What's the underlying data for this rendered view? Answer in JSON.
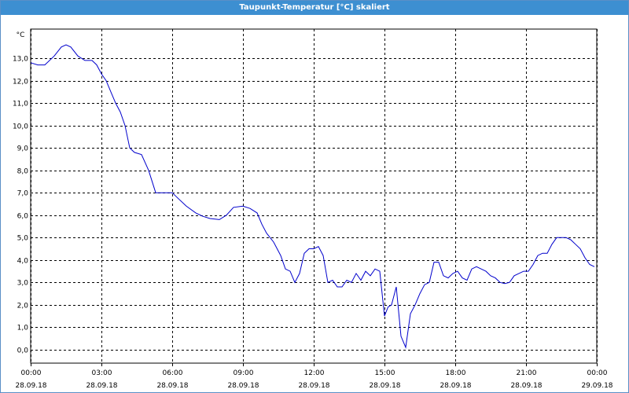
{
  "window": {
    "title": "Taupunkt-Temperatur [°C] skaliert"
  },
  "colors": {
    "title_bar": "#3d8fd1",
    "line": "#0000cc",
    "grid": "#000000",
    "background": "#ffffff"
  },
  "chart_data": {
    "type": "line",
    "title": "Taupunkt-Temperatur [°C] skaliert",
    "ylabel": "°C",
    "xlabel": "",
    "ylim": [
      -0.6,
      14.3
    ],
    "xlim": [
      0,
      24
    ],
    "grid": true,
    "y_ticks": [
      {
        "value": 0,
        "label": "0,0"
      },
      {
        "value": 1,
        "label": "1,0"
      },
      {
        "value": 2,
        "label": "2,0"
      },
      {
        "value": 3,
        "label": "3,0"
      },
      {
        "value": 4,
        "label": "4,0"
      },
      {
        "value": 5,
        "label": "5,0"
      },
      {
        "value": 6,
        "label": "6,0"
      },
      {
        "value": 7,
        "label": "7,0"
      },
      {
        "value": 8,
        "label": "8,0"
      },
      {
        "value": 9,
        "label": "9,0"
      },
      {
        "value": 10,
        "label": "10,0"
      },
      {
        "value": 11,
        "label": "11,0"
      },
      {
        "value": 12,
        "label": "12,0"
      },
      {
        "value": 13,
        "label": "13,0"
      }
    ],
    "x_ticks": [
      {
        "value": 0,
        "time": "00:00",
        "date": "28.09.18"
      },
      {
        "value": 3,
        "time": "03:00",
        "date": "28.09.18"
      },
      {
        "value": 6,
        "time": "06:00",
        "date": "28.09.18"
      },
      {
        "value": 9,
        "time": "09:00",
        "date": "28.09.18"
      },
      {
        "value": 12,
        "time": "12:00",
        "date": "28.09.18"
      },
      {
        "value": 15,
        "time": "15:00",
        "date": "28.09.18"
      },
      {
        "value": 18,
        "time": "18:00",
        "date": "28.09.18"
      },
      {
        "value": 21,
        "time": "21:00",
        "date": "28.09.18"
      },
      {
        "value": 24,
        "time": "00:00",
        "date": "29.09.18"
      }
    ],
    "series": [
      {
        "x": [
          0,
          0.3,
          0.6,
          1.0,
          1.3,
          1.5,
          1.7,
          2.0,
          2.3,
          2.6,
          2.8,
          3.0,
          3.2,
          3.4,
          3.6,
          3.8,
          4.0,
          4.2,
          4.4,
          4.7,
          5.0,
          5.3,
          5.6,
          6.0,
          6.3,
          6.6,
          7.0,
          7.3,
          7.6,
          8.0,
          8.3,
          8.6,
          9.0,
          9.3,
          9.6,
          9.8,
          10.0,
          10.3,
          10.6,
          10.8,
          11.0,
          11.2,
          11.4,
          11.6,
          11.8,
          12.0,
          12.2,
          12.4,
          12.6,
          12.8,
          13.0,
          13.2,
          13.4,
          13.6,
          13.8,
          14.0,
          14.2,
          14.4,
          14.6,
          14.8,
          15.0,
          15.15,
          15.3,
          15.5,
          15.7,
          15.9,
          16.1,
          16.3,
          16.5,
          16.7,
          16.9,
          17.1,
          17.3,
          17.5,
          17.7,
          17.9,
          18.1,
          18.3,
          18.5,
          18.7,
          18.9,
          19.1,
          19.3,
          19.5,
          19.7,
          19.9,
          20.1,
          20.3,
          20.5,
          20.7,
          20.9,
          21.1,
          21.3,
          21.5,
          21.7,
          21.9,
          22.1,
          22.3,
          22.5,
          22.7,
          22.9,
          23.1,
          23.3,
          23.5,
          23.7,
          23.9
        ],
        "values": [
          12.8,
          12.7,
          12.7,
          13.1,
          13.5,
          13.6,
          13.5,
          13.1,
          12.9,
          12.9,
          12.7,
          12.3,
          12.0,
          11.5,
          11.0,
          10.6,
          10.0,
          9.0,
          8.8,
          8.7,
          8.0,
          7.0,
          7.0,
          7.0,
          6.7,
          6.4,
          6.1,
          5.95,
          5.85,
          5.8,
          6.0,
          6.35,
          6.4,
          6.3,
          6.1,
          5.6,
          5.2,
          4.8,
          4.2,
          3.6,
          3.5,
          3.0,
          3.4,
          4.3,
          4.5,
          4.5,
          4.6,
          4.2,
          3.0,
          3.1,
          2.8,
          2.8,
          3.1,
          3.0,
          3.4,
          3.1,
          3.5,
          3.3,
          3.6,
          3.5,
          1.5,
          1.9,
          2.0,
          2.8,
          0.6,
          0.1,
          1.6,
          2.0,
          2.5,
          2.9,
          3.0,
          3.9,
          3.9,
          3.3,
          3.2,
          3.4,
          3.5,
          3.2,
          3.1,
          3.6,
          3.7,
          3.6,
          3.5,
          3.3,
          3.2,
          3.0,
          2.95,
          3.0,
          3.3,
          3.4,
          3.5,
          3.5,
          3.8,
          4.2,
          4.3,
          4.3,
          4.7,
          5.0,
          5.0,
          5.0,
          4.9,
          4.7,
          4.5,
          4.1,
          3.8,
          3.7
        ]
      }
    ]
  }
}
